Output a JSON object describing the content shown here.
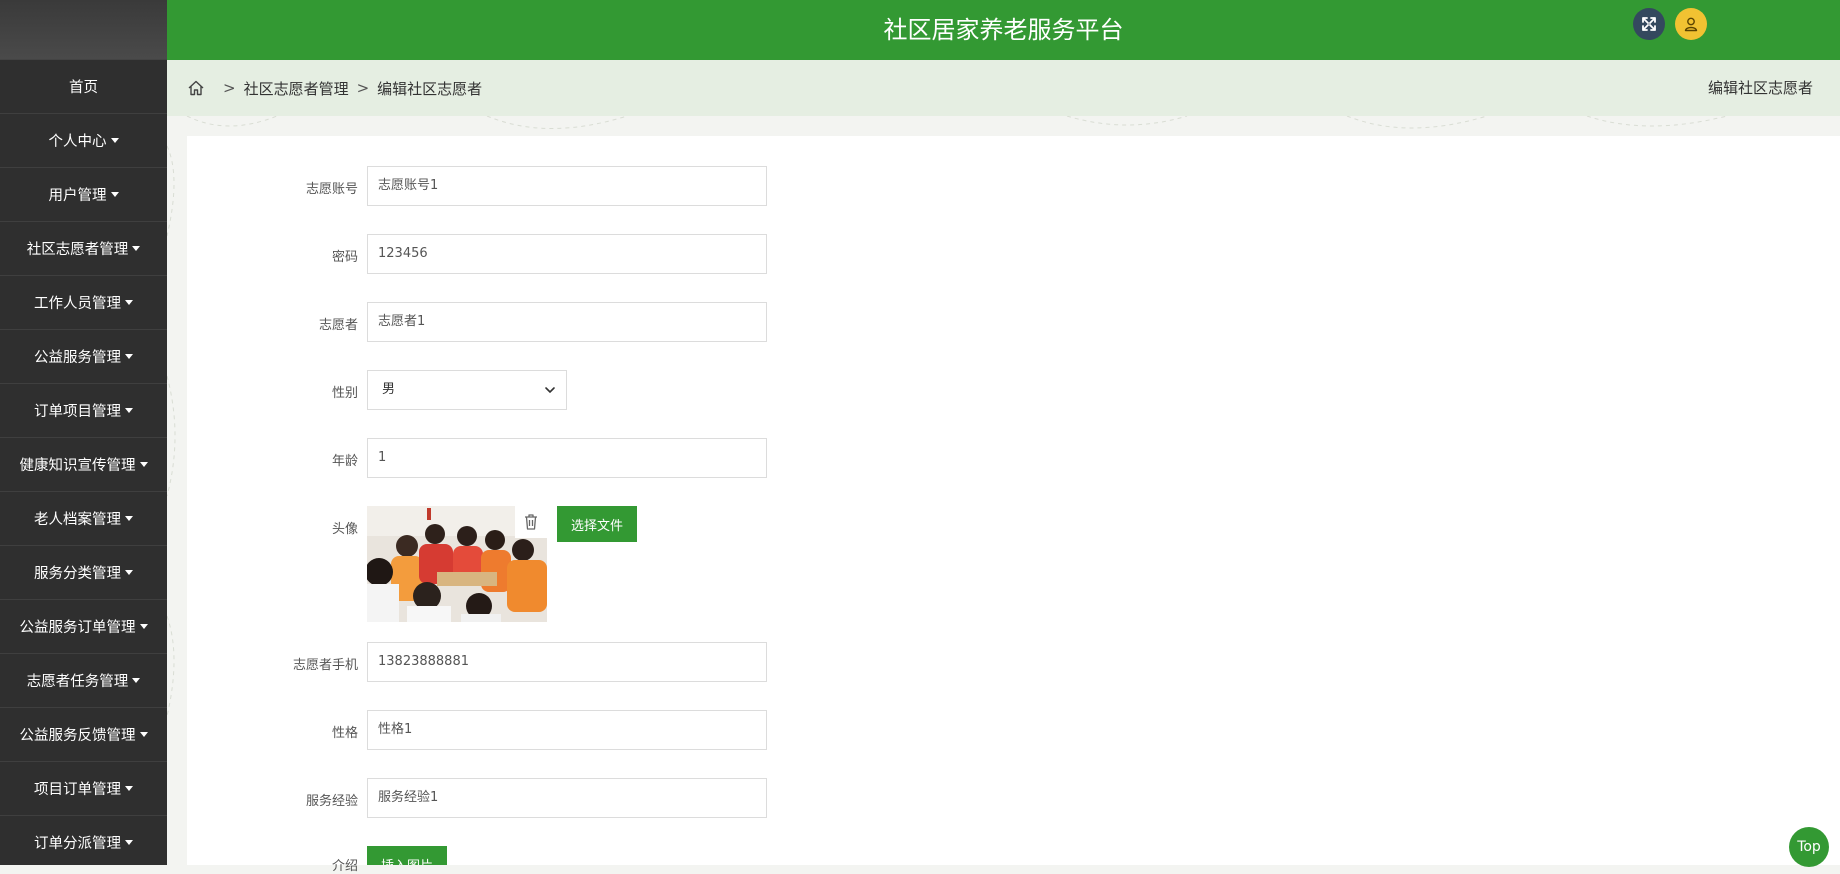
{
  "header": {
    "title": "社区居家养老服务平台"
  },
  "sidebar": {
    "items": [
      {
        "label": "首页",
        "has_caret": false
      },
      {
        "label": "个人中心",
        "has_caret": true
      },
      {
        "label": "用户管理",
        "has_caret": true
      },
      {
        "label": "社区志愿者管理",
        "has_caret": true
      },
      {
        "label": "工作人员管理",
        "has_caret": true
      },
      {
        "label": "公益服务管理",
        "has_caret": true
      },
      {
        "label": "订单项目管理",
        "has_caret": true
      },
      {
        "label": "健康知识宣传管理",
        "has_caret": true
      },
      {
        "label": "老人档案管理",
        "has_caret": true
      },
      {
        "label": "服务分类管理",
        "has_caret": true
      },
      {
        "label": "公益服务订单管理",
        "has_caret": true
      },
      {
        "label": "志愿者任务管理",
        "has_caret": true
      },
      {
        "label": "公益服务反馈管理",
        "has_caret": true
      },
      {
        "label": "项目订单管理",
        "has_caret": true
      },
      {
        "label": "订单分派管理",
        "has_caret": true
      }
    ]
  },
  "breadcrumb": {
    "sep": ">",
    "level1": "社区志愿者管理",
    "level2": "编辑社区志愿者",
    "right_title": "编辑社区志愿者"
  },
  "form": {
    "account": {
      "label": "志愿账号",
      "value": "志愿账号1"
    },
    "password": {
      "label": "密码",
      "value": "123456"
    },
    "name": {
      "label": "志愿者",
      "value": "志愿者1"
    },
    "gender": {
      "label": "性别",
      "value": "男"
    },
    "age": {
      "label": "年龄",
      "value": "1"
    },
    "avatar": {
      "label": "头像",
      "choose_file": "选择文件"
    },
    "phone": {
      "label": "志愿者手机",
      "value": "13823888881"
    },
    "personality": {
      "label": "性格",
      "value": "性格1"
    },
    "experience": {
      "label": "服务经验",
      "value": "服务经验1"
    },
    "intro": {
      "label": "介绍",
      "insert_image": "插入图片"
    }
  },
  "top_button": "Top",
  "colors": {
    "brand_green": "#339933",
    "sidebar_bg": "#2f2f2f",
    "breadcrumb_bg": "#e5eee2"
  }
}
